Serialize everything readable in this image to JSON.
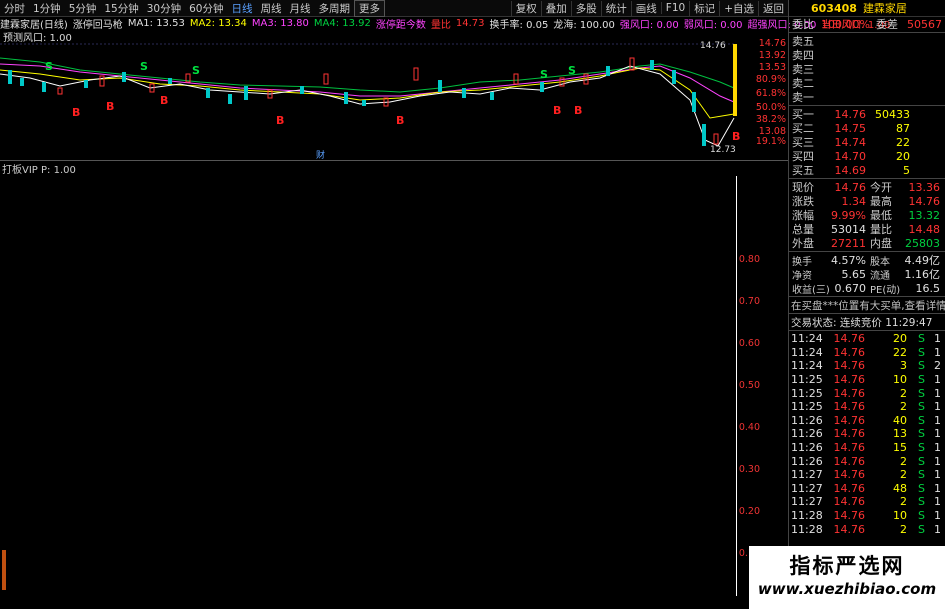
{
  "toolbar": {
    "items": [
      "分时",
      "1分钟",
      "5分钟",
      "15分钟",
      "30分钟",
      "60分钟",
      "日线",
      "周线",
      "月线",
      "多周期",
      "更多"
    ],
    "active": "日线",
    "right": [
      "复权",
      "叠加",
      "多股",
      "统计",
      "画线",
      "F10",
      "标记",
      "+自选",
      "返回"
    ]
  },
  "infoline": {
    "title": "建霖家居(日线)",
    "indicator": "涨停回马枪",
    "ma1": "MA1: 13.53",
    "ma2": "MA2: 13.34",
    "ma3": "MA3: 13.80",
    "ma4": "MA4: 13.92",
    "zt": "涨停距今数",
    "lb": "量比",
    "lb_val": "14.73",
    "hs": "换手率: 0.05",
    "lh": "龙海: 100.00",
    "qf": "强风口: 0.00",
    "ruo": "弱风口: 0.00",
    "chao": "超强风口: 0.00",
    "dr": "当日风口: 1.00"
  },
  "yuce": "预测风口: 1.00",
  "price_axis": [
    "14.76",
    "13.92",
    "13.53",
    "13.08",
    "80.9%",
    "61.8%",
    "50.0%",
    "38.2%",
    "19.1%"
  ],
  "chart_labels": {
    "high": "14.76",
    "low": "12.73",
    "cai": "财"
  },
  "signals_S": "S",
  "signals_B": "B",
  "indicator_title": "打板VIP P: 1.00",
  "ind_axis": [
    "0.80",
    "0.70",
    "0.60",
    "0.50",
    "0.40",
    "0.30",
    "0.20",
    "0.10"
  ],
  "right_panel": {
    "code": "603408",
    "name": "建霖家居",
    "weibi_lbl": "委比",
    "weibi_val": "100.00%",
    "weicha_lbl": "委差",
    "weicha_val": "50567",
    "sells": [
      "卖五",
      "卖四",
      "卖三",
      "卖二",
      "卖一"
    ],
    "buys": [
      {
        "lbl": "买一",
        "price": "14.76",
        "vol": "50433"
      },
      {
        "lbl": "买二",
        "price": "14.75",
        "vol": "87"
      },
      {
        "lbl": "买三",
        "price": "14.74",
        "vol": "22"
      },
      {
        "lbl": "买四",
        "price": "14.70",
        "vol": "20"
      },
      {
        "lbl": "买五",
        "price": "14.69",
        "vol": "5"
      }
    ],
    "stats": [
      {
        "l1": "现价",
        "v1": "14.76",
        "l2": "今开",
        "v2": "13.36",
        "c1": "red",
        "c2": "red"
      },
      {
        "l1": "涨跌",
        "v1": "1.34",
        "l2": "最高",
        "v2": "14.76",
        "c1": "red",
        "c2": "red"
      },
      {
        "l1": "涨幅",
        "v1": "9.99%",
        "l2": "最低",
        "v2": "13.32",
        "c1": "red",
        "c2": "green"
      },
      {
        "l1": "总量",
        "v1": "53014",
        "l2": "量比",
        "v2": "14.48",
        "c1": "white",
        "c2": "red"
      },
      {
        "l1": "外盘",
        "v1": "27211",
        "l2": "内盘",
        "v2": "25803",
        "c1": "red",
        "c2": "green"
      }
    ],
    "stats2": [
      {
        "l1": "换手",
        "v1": "4.57%",
        "l2": "股本",
        "v2": "4.49亿"
      },
      {
        "l1": "净资",
        "v1": "5.65",
        "l2": "流通",
        "v2": "1.16亿"
      },
      {
        "l1": "收益(三)",
        "v1": "0.670",
        "l2": "PE(动)",
        "v2": "16.5"
      }
    ],
    "notice": "在买盘***位置有大买单,查看详情",
    "state": "交易状态: 连续竞价 11:29:47",
    "ticks": [
      {
        "t": "11:24",
        "p": "14.76",
        "v": "20",
        "s": "S",
        "n": "1"
      },
      {
        "t": "11:24",
        "p": "14.76",
        "v": "22",
        "s": "S",
        "n": "1"
      },
      {
        "t": "11:24",
        "p": "14.76",
        "v": "3",
        "s": "S",
        "n": "2"
      },
      {
        "t": "11:25",
        "p": "14.76",
        "v": "10",
        "s": "S",
        "n": "1"
      },
      {
        "t": "11:25",
        "p": "14.76",
        "v": "2",
        "s": "S",
        "n": "1"
      },
      {
        "t": "11:25",
        "p": "14.76",
        "v": "2",
        "s": "S",
        "n": "1"
      },
      {
        "t": "11:26",
        "p": "14.76",
        "v": "40",
        "s": "S",
        "n": "1"
      },
      {
        "t": "11:26",
        "p": "14.76",
        "v": "13",
        "s": "S",
        "n": "1"
      },
      {
        "t": "11:26",
        "p": "14.76",
        "v": "15",
        "s": "S",
        "n": "1"
      },
      {
        "t": "11:26",
        "p": "14.76",
        "v": "2",
        "s": "S",
        "n": "1"
      },
      {
        "t": "11:27",
        "p": "14.76",
        "v": "2",
        "s": "S",
        "n": "1"
      },
      {
        "t": "11:27",
        "p": "14.76",
        "v": "48",
        "s": "S",
        "n": "1"
      },
      {
        "t": "11:27",
        "p": "14.76",
        "v": "2",
        "s": "S",
        "n": "1"
      },
      {
        "t": "11:28",
        "p": "14.76",
        "v": "10",
        "s": "S",
        "n": "1"
      },
      {
        "t": "11:28",
        "p": "14.76",
        "v": "2",
        "s": "S",
        "n": "1"
      }
    ]
  },
  "watermark": {
    "line1": "指标严选网",
    "line2": "www.xuezhibiao.com"
  }
}
